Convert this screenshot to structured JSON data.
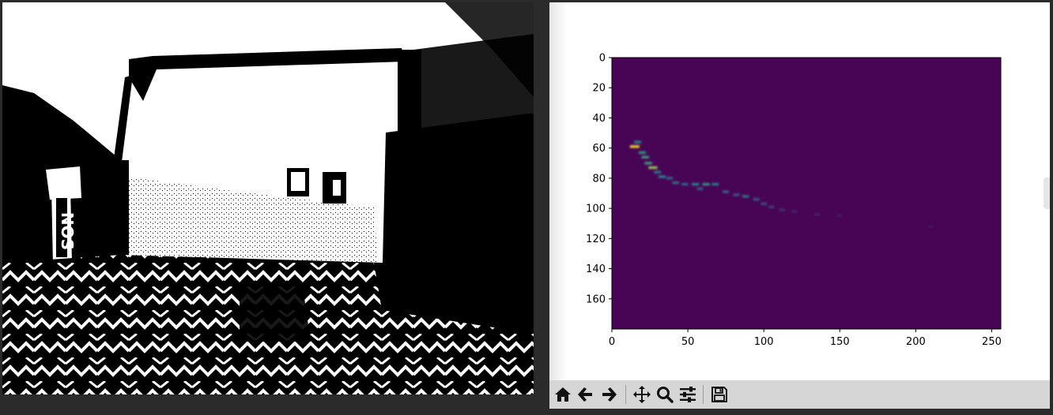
{
  "camera_window": {
    "description_icon": "binary-thresholded-camera-frame",
    "can_text_lines": [
      "N",
      "O",
      "S"
    ]
  },
  "plot_window": {
    "colors": {
      "background_min": "#440154",
      "plot_fill": "#480556",
      "toolbar_bg": "#d6d6d6"
    },
    "toolbar": {
      "buttons": [
        {
          "name": "home-icon",
          "tooltip": ""
        },
        {
          "name": "back-arrow-icon",
          "tooltip": ""
        },
        {
          "name": "forward-arrow-icon",
          "tooltip": ""
        },
        {
          "name": "pan-icon",
          "tooltip": ""
        },
        {
          "name": "zoom-icon",
          "tooltip": ""
        },
        {
          "name": "configure-subplots-icon",
          "tooltip": ""
        },
        {
          "name": "save-icon",
          "tooltip": ""
        }
      ]
    }
  },
  "chart_data": {
    "type": "heatmap",
    "title": "",
    "xlabel": "",
    "ylabel": "",
    "xlim": [
      0,
      256
    ],
    "ylim": [
      180,
      0
    ],
    "x_ticks": [
      0,
      50,
      100,
      150,
      200,
      250
    ],
    "y_ticks": [
      0,
      20,
      40,
      60,
      80,
      100,
      120,
      140,
      160
    ],
    "x_tick_labels": [
      "0",
      "50",
      "100",
      "150",
      "200",
      "250"
    ],
    "y_tick_labels": [
      "0",
      "20",
      "40",
      "60",
      "80",
      "100",
      "120",
      "140",
      "160"
    ],
    "colormap": "viridis",
    "hot_spots": [
      {
        "x": 15,
        "y": 59,
        "intensity": 1.0
      },
      {
        "x": 17,
        "y": 56,
        "intensity": 0.5
      },
      {
        "x": 20,
        "y": 63,
        "intensity": 0.55
      },
      {
        "x": 22,
        "y": 66,
        "intensity": 0.6
      },
      {
        "x": 24,
        "y": 70,
        "intensity": 0.6
      },
      {
        "x": 27,
        "y": 73,
        "intensity": 0.85
      },
      {
        "x": 30,
        "y": 76,
        "intensity": 0.45
      },
      {
        "x": 33,
        "y": 79,
        "intensity": 0.5
      },
      {
        "x": 38,
        "y": 80,
        "intensity": 0.35
      },
      {
        "x": 42,
        "y": 83,
        "intensity": 0.4
      },
      {
        "x": 48,
        "y": 84,
        "intensity": 0.35
      },
      {
        "x": 55,
        "y": 84,
        "intensity": 0.5
      },
      {
        "x": 62,
        "y": 84,
        "intensity": 0.55
      },
      {
        "x": 68,
        "y": 84,
        "intensity": 0.45
      },
      {
        "x": 58,
        "y": 87,
        "intensity": 0.3
      },
      {
        "x": 75,
        "y": 89,
        "intensity": 0.35
      },
      {
        "x": 82,
        "y": 91,
        "intensity": 0.3
      },
      {
        "x": 88,
        "y": 92,
        "intensity": 0.4
      },
      {
        "x": 95,
        "y": 94,
        "intensity": 0.3
      },
      {
        "x": 100,
        "y": 97,
        "intensity": 0.25
      },
      {
        "x": 105,
        "y": 99,
        "intensity": 0.2
      },
      {
        "x": 112,
        "y": 101,
        "intensity": 0.15
      },
      {
        "x": 120,
        "y": 102,
        "intensity": 0.12
      },
      {
        "x": 135,
        "y": 104,
        "intensity": 0.1
      },
      {
        "x": 150,
        "y": 105,
        "intensity": 0.08
      },
      {
        "x": 210,
        "y": 112,
        "intensity": 0.06
      }
    ]
  }
}
